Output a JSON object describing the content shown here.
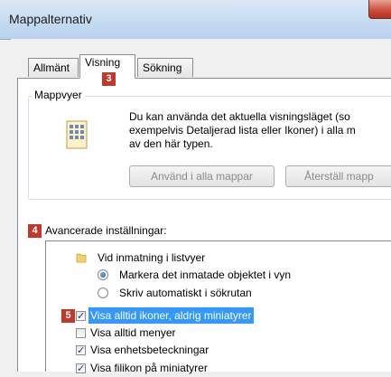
{
  "window": {
    "title": "Mappalternativ"
  },
  "tabs": [
    {
      "label": "Allmänt",
      "active": false
    },
    {
      "label": "Visning",
      "active": true
    },
    {
      "label": "Sökning",
      "active": false
    }
  ],
  "badges": {
    "b3": "3",
    "b4": "4",
    "b5": "5"
  },
  "folder_views": {
    "legend": "Mappvyer",
    "description_line1": "Du kan använda det aktuella visningsläget (so",
    "description_line2": "exempelvis Detaljerad lista eller Ikoner) i alla m",
    "description_line3": "av den här typen.",
    "apply_button": "Använd i alla mappar",
    "reset_button": "Återställ mapp"
  },
  "advanced": {
    "label": "Avancerade inställningar:",
    "items": [
      {
        "type": "folder",
        "label": "Vid inmatning i listvyer"
      },
      {
        "type": "radio",
        "label": "Markera det inmatade objektet i vyn",
        "checked": true
      },
      {
        "type": "radio",
        "label": "Skriv automatiskt i sökrutan",
        "checked": false
      },
      {
        "type": "checkbox",
        "label": "Visa alltid ikoner, aldrig miniatyrer",
        "checked": true,
        "selected": true
      },
      {
        "type": "checkbox",
        "label": "Visa alltid menyer",
        "checked": false
      },
      {
        "type": "checkbox",
        "label": "Visa enhetsbeteckningar",
        "checked": true
      },
      {
        "type": "checkbox",
        "label": "Visa filikon på miniatyrer",
        "checked": true
      }
    ]
  },
  "colors": {
    "selection": "#3399ff",
    "badge": "#c0392b",
    "title_gradient": "#c6dbf1"
  }
}
